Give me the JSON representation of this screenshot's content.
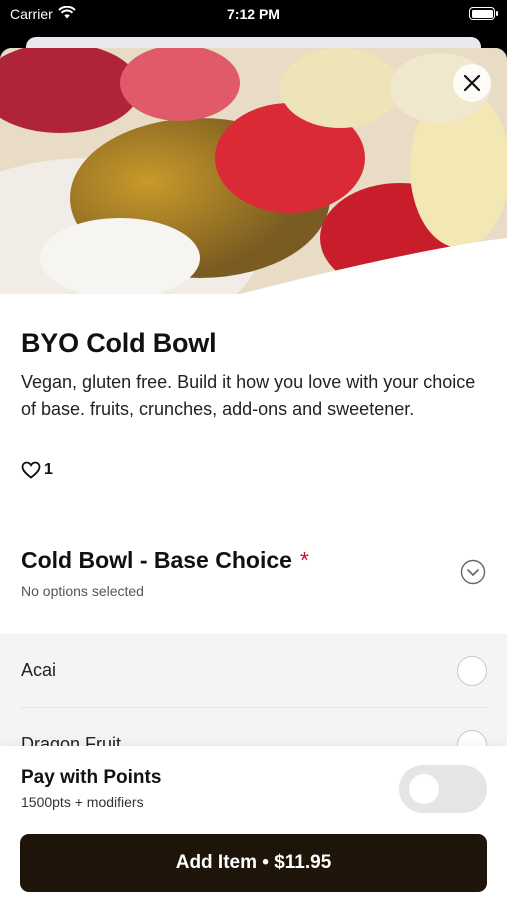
{
  "status_bar": {
    "carrier": "Carrier",
    "time": "7:12 PM"
  },
  "icons": {
    "wifi": "wifi-icon",
    "battery": "battery-icon",
    "close": "close-icon",
    "heart": "heart-outline-icon",
    "chevron": "chevron-down-circle-icon"
  },
  "item": {
    "title": "BYO Cold Bowl",
    "description": "Vegan, gluten free. Build it how you love with your choice of base. fruits, crunches, add-ons and sweetener.",
    "likes": "1"
  },
  "section": {
    "title": "Cold Bowl - Base Choice",
    "required_mark": "*",
    "subtitle": "No options selected",
    "options": [
      {
        "label": "Acai"
      },
      {
        "label": "Dragon Fruit"
      }
    ]
  },
  "footer": {
    "points_title": "Pay with Points",
    "points_sub": "1500pts + modifiers",
    "toggle_on": false,
    "add_button": "Add Item • $11.95"
  },
  "colors": {
    "accent": "#c8102e",
    "button": "#1f140a"
  }
}
